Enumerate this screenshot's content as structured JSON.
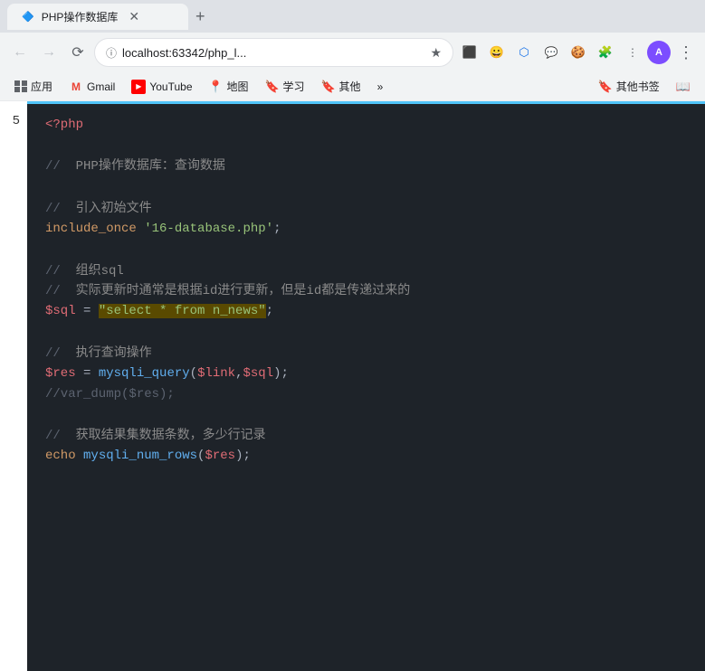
{
  "browser": {
    "nav": {
      "back_disabled": true,
      "forward_disabled": true,
      "address": "localhost:63342/php_l...",
      "address_full": "localhost:63342/php_l..."
    },
    "bookmarks": [
      {
        "id": "apps",
        "label": "应用",
        "icon": "⊞",
        "type": "app"
      },
      {
        "id": "gmail",
        "label": "Gmail",
        "icon": "M",
        "color": "#EA4335"
      },
      {
        "id": "youtube",
        "label": "YouTube",
        "icon": "▶",
        "color": "#FF0000"
      },
      {
        "id": "maps",
        "label": "地图",
        "icon": "📍",
        "color": "#34A853"
      },
      {
        "id": "study",
        "label": "学习",
        "icon": "🔖",
        "color": "#FBBC05"
      },
      {
        "id": "other",
        "label": "其他",
        "icon": "🔖",
        "color": "#FBBC05"
      },
      {
        "id": "more",
        "label": "»",
        "type": "more"
      },
      {
        "id": "otherbookmarks",
        "label": "其他书签",
        "icon": "🔖",
        "color": "#FBBC05"
      },
      {
        "id": "readinglist",
        "label": "📖",
        "type": "icon"
      }
    ]
  },
  "page": {
    "line_number": "5",
    "code": {
      "line1": "<?php",
      "line2": "",
      "line3": "//  PHP操作数据库：查询数据",
      "line4": "",
      "line5": "//  引入初始文件",
      "line6_keyword": "include_once",
      "line6_string": " '16-database.php';",
      "line7": "",
      "line8": "//  组织sql",
      "line9": "//  实际更新时通常是根据id进行更新，但是id都是传递过来的",
      "line10_var": "$sql",
      "line10_op": " = ",
      "line10_str_highlight": "\"select * from n_news\"",
      "line10_end": ";",
      "line11": "",
      "line12": "//  执行查询操作",
      "line13_var": "$res",
      "line13_op": " = ",
      "line13_func": "mysqli_query",
      "line13_params": "($link,$sql);",
      "line14_comment": "//var_dump($res);",
      "line15": "",
      "line16": "//  获取结果集数据条数，多少行记录",
      "line17_keyword": "echo",
      "line17_func": " mysqli_num_rows",
      "line17_params": "($res);"
    }
  }
}
